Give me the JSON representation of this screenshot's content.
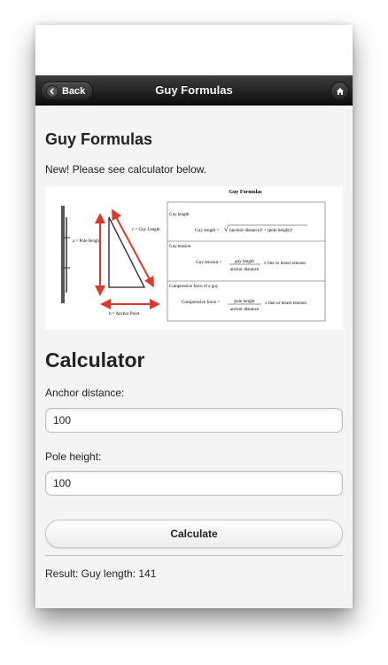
{
  "header": {
    "back_label": "Back",
    "title": "Guy Formulas"
  },
  "page": {
    "title": "Guy Formulas",
    "intro": "New! Please see calculator below."
  },
  "figure": {
    "title": "Guy Formulas",
    "diagram": {
      "pole_label": "a = Pole Height",
      "guy_label": "c = Guy Length",
      "anchor_label": "b = Anchor Point"
    },
    "sections": [
      {
        "heading": "Guy length",
        "lhs": "Guy length =",
        "formula": "(anchor distance)² + (pole height)²"
      },
      {
        "heading": "Guy tension",
        "lhs": "Guy tension =",
        "numerator": "guy length",
        "denominator": "anchor distance",
        "suffix": "x  line or bisect tension"
      },
      {
        "heading": "Compressive force of a guy",
        "lhs": "Compressive force =",
        "numerator": "pole height",
        "denominator": "anchor distance",
        "suffix": "x  line or bisect tension"
      }
    ]
  },
  "calculator": {
    "title": "Calculator",
    "anchor_label": "Anchor distance:",
    "anchor_value": "100",
    "pole_label": "Pole height:",
    "pole_value": "100",
    "button_label": "Calculate",
    "result": "Result: Guy length: 141"
  },
  "colors": {
    "header_bg": "#1a1a1a",
    "arrow_red": "#d93a2b",
    "page_bg": "#f4f4f4"
  }
}
